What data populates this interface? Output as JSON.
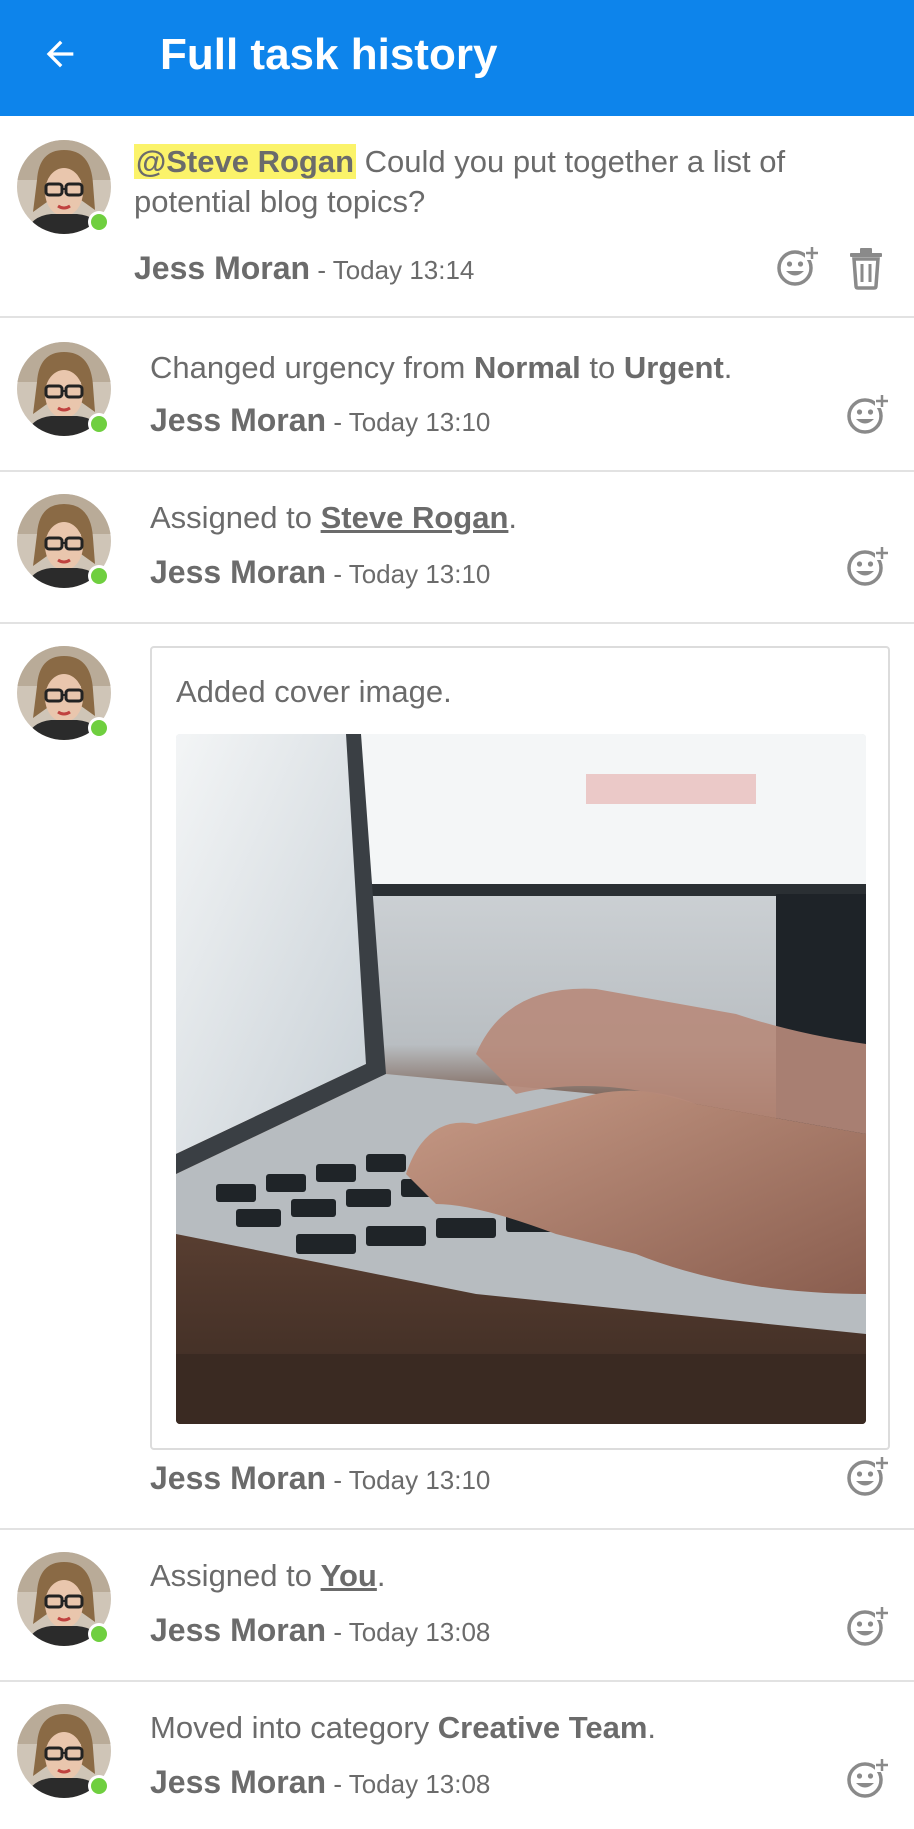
{
  "header": {
    "title": "Full task history"
  },
  "author_name": "Jess Moran",
  "comment": {
    "mention": "@Steve Rogan",
    "text": " Could you put together a list of potential blog topics?",
    "time": "- Today 13:14"
  },
  "events": [
    {
      "prefix": "Changed urgency from ",
      "from": "Normal",
      "mid": " to ",
      "to": "Urgent",
      "suffix": ".",
      "time": "- Today 13:10"
    },
    {
      "prefix": "Assigned to ",
      "target": "Steve Rogan",
      "suffix": ".",
      "time": "- Today 13:10"
    },
    {
      "text": "Added cover image.",
      "time": "- Today 13:10"
    },
    {
      "prefix": "Assigned to ",
      "target": "You",
      "suffix": ".",
      "time": "- Today 13:08"
    },
    {
      "prefix": "Moved into category ",
      "target": "Creative Team",
      "suffix": ".",
      "time": "- Today 13:08"
    }
  ],
  "icons": {
    "back": "arrow-left-icon",
    "reaction": "add-reaction-icon",
    "delete": "trash-icon",
    "presence": "online-dot"
  },
  "colors": {
    "appbar": "#0d84eb",
    "mention_bg": "#fbf36a",
    "online": "#6fcf3f",
    "text": "#6b6b6b"
  }
}
